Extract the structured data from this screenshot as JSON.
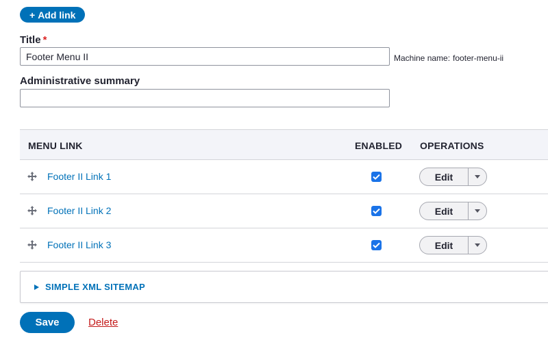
{
  "actions_top": {
    "add_link_label": "Add link",
    "add_link_icon": "plus-icon"
  },
  "form": {
    "title_label": "Title",
    "title_required_mark": "*",
    "title_value": "Footer Menu II",
    "machine_name_label": "Machine name:",
    "machine_name_value": "footer-menu-ii",
    "summary_label": "Administrative summary",
    "summary_value": ""
  },
  "table": {
    "headers": {
      "menu_link": "MENU LINK",
      "enabled": "ENABLED",
      "operations": "OPERATIONS"
    },
    "rows": [
      {
        "label": "Footer II Link 1",
        "enabled": true,
        "operation": "Edit"
      },
      {
        "label": "Footer II Link 2",
        "enabled": true,
        "operation": "Edit"
      },
      {
        "label": "Footer II Link 3",
        "enabled": true,
        "operation": "Edit"
      }
    ]
  },
  "details": {
    "summary_label": "SIMPLE XML SITEMAP",
    "collapsed": true
  },
  "actions_bottom": {
    "save_label": "Save",
    "delete_label": "Delete"
  },
  "colors": {
    "primary": "#0071b8",
    "danger": "#c41b1b",
    "checkbox": "#1a73e8",
    "table_header_bg": "#f3f4f9"
  }
}
